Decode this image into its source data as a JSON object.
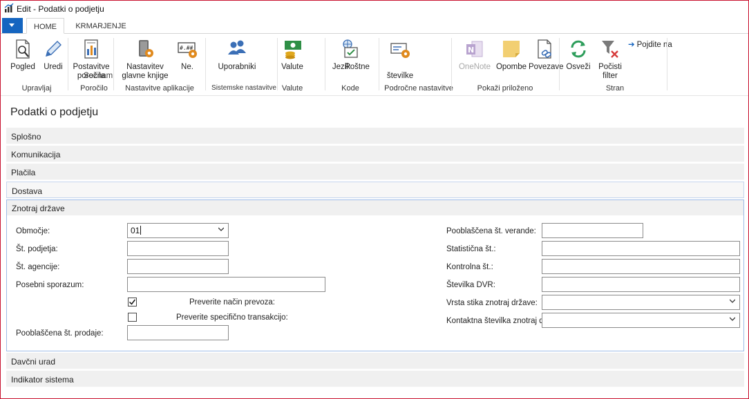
{
  "window": {
    "title": "Edit - Podatki o podjetju"
  },
  "tabs": {
    "home": "HOME",
    "navigate": "KRMARJENJE"
  },
  "ribbon": {
    "buttons": {
      "pogled": "Pogled",
      "uredi": "Uredi",
      "postavitve": "Postavitve\nporočila",
      "seznam": "Seznam",
      "nastavitev_gk": "Nastavitev\nglavne knjige",
      "ne": "Ne.",
      "uporabniki": "Uporabniki",
      "valute": "Valute",
      "jezik": "Jezik",
      "postne": "Poštne",
      "stevilke": "številke",
      "onenote": "OneNote",
      "opombe": "Opombe",
      "povezave": "Povezave",
      "osvezi": "Osveži",
      "pocisti": "Počisti\nfilter",
      "pojdite": "Pojdite na"
    },
    "groups": {
      "upravljaj": "Upravljaj",
      "porocilo": "Poročilo",
      "nastavitve_app": "Nastavitve aplikacije",
      "sistemske": "Sistemske nastavitve",
      "valute": "Valute",
      "kode": "Kode",
      "podrocne": "Področne nastavitve",
      "prilozeno": "Pokaži priloženo",
      "stran": "Stran"
    },
    "icons": {
      "pogled": "view-icon",
      "uredi": "edit-pencil-icon",
      "postavitve": "report-layout-icon",
      "nastavitev_gk": "general-ledger-setup-icon",
      "ne": "number-series-icon",
      "uporabniki": "users-icon",
      "valute": "currency-icon",
      "jezik": "language-icon",
      "postne": "postcode-icon",
      "onenote": "onenote-icon",
      "opombe": "note-icon",
      "povezave": "link-icon",
      "osvezi": "refresh-icon",
      "pocisti": "clear-filter-icon",
      "pojdite": "arrow-right-icon"
    }
  },
  "page": {
    "title": "Podatki o podjetju"
  },
  "fasttabs": {
    "splosno": "Splošno",
    "komunikacija": "Komunikacija",
    "placila": "Plačila",
    "dostava": "Dostava",
    "znotraj": "Znotraj države",
    "davcni": "Davčni urad",
    "indikator": "Indikator sistema"
  },
  "intrastat": {
    "left": {
      "obmocje_label": "Območje:",
      "obmocje_value": "01",
      "st_podjetja_label": "Št. podjetja:",
      "st_podjetja_value": "",
      "st_agencije_label": "Št. agencije:",
      "st_agencije_value": "",
      "posebni_label": "Posebni sporazum:",
      "posebni_value": "",
      "preverite_nacin_label": "Preverite način prevoza:",
      "preverite_nacin_checked": true,
      "preverite_spec_label": "Preverite specifično transakcijo:",
      "preverite_spec_checked": false,
      "pooblascena_prodaje_label": "Pooblaščena št. prodaje:",
      "pooblascena_prodaje_value": ""
    },
    "right": {
      "pooblascena_verande_label": "Pooblaščena št. verande:",
      "pooblascena_verande_value": "",
      "statisticna_label": "Statistična št.:",
      "statisticna_value": "",
      "kontrolna_label": "Kontrolna št.:",
      "kontrolna_value": "",
      "dvr_label": "Številka DVR:",
      "dvr_value": "",
      "vrsta_stika_label": "Vrsta stika znotraj države:",
      "vrsta_stika_value": "",
      "kontaktna_label": "Kontaktna številka znotraj države:",
      "kontaktna_value": ""
    }
  },
  "colors": {
    "accent": "#1565c0",
    "window_border": "#c8102e",
    "fasttab_bg": "#f0f0f0",
    "section_border": "#9dbbe6"
  }
}
